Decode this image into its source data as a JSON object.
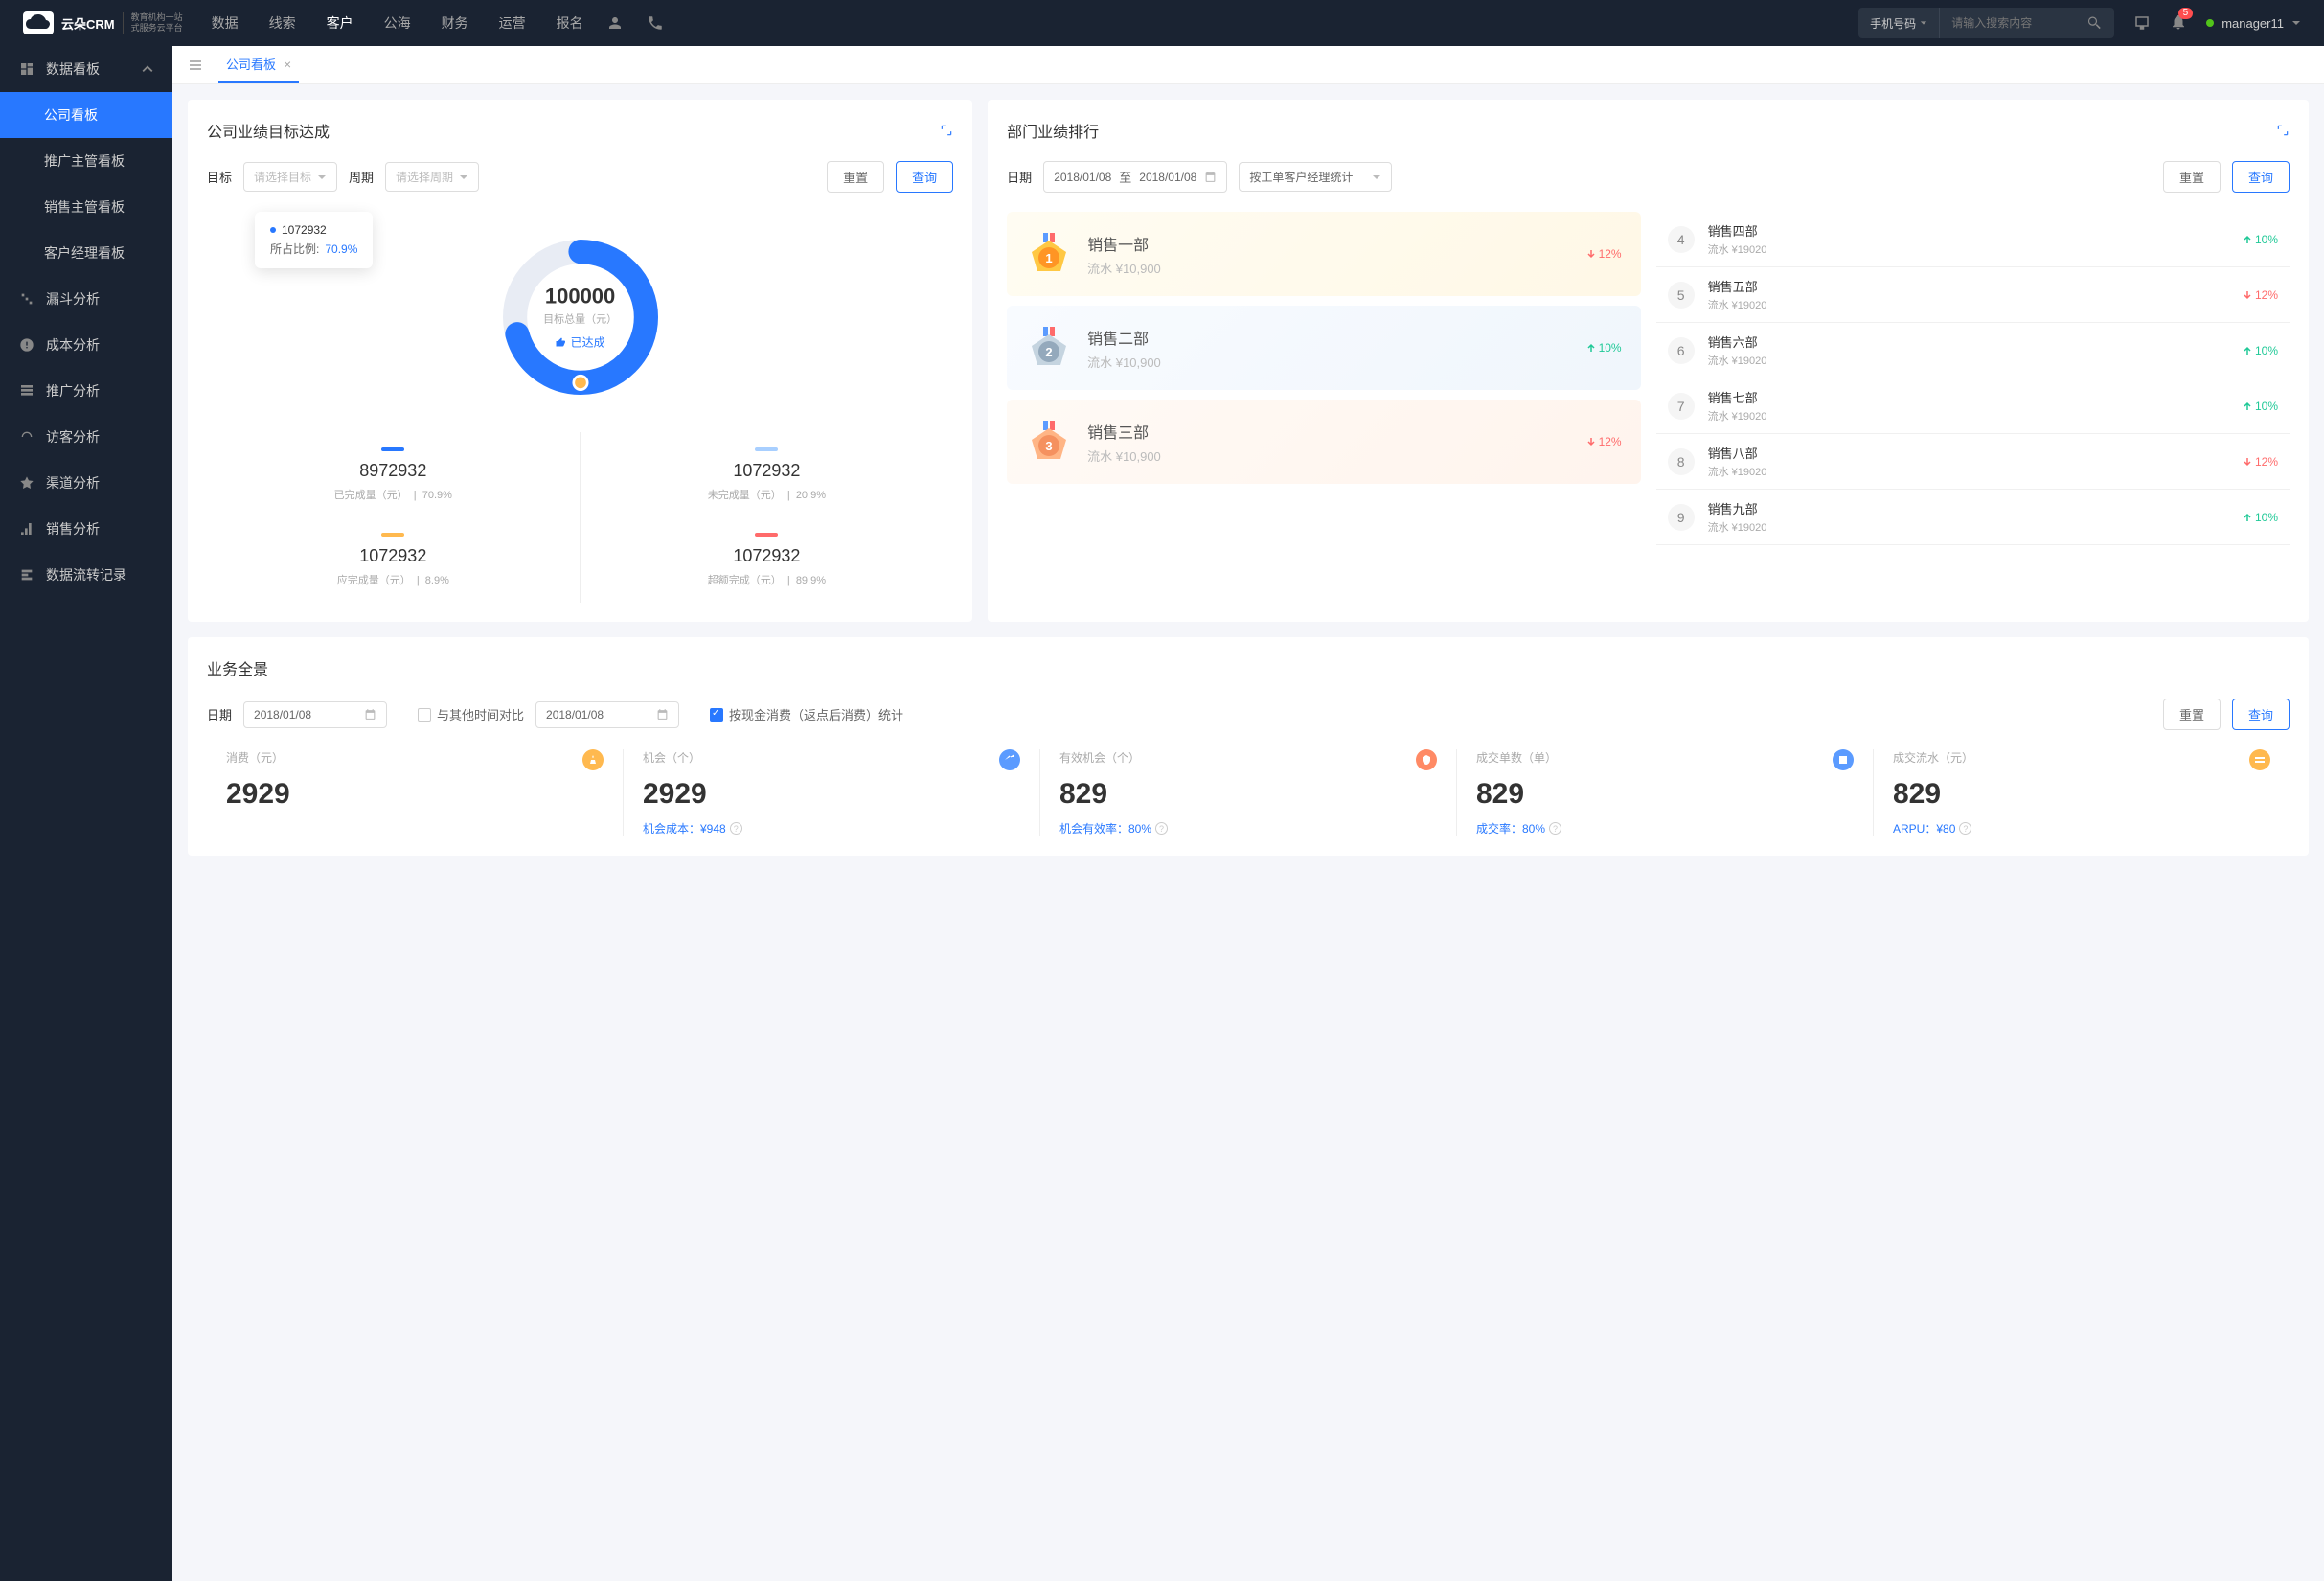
{
  "brand": {
    "name": "云朵CRM",
    "sub1": "教育机构一站",
    "sub2": "式服务云平台"
  },
  "nav": [
    "数据",
    "线索",
    "客户",
    "公海",
    "财务",
    "运营",
    "报名"
  ],
  "nav_active": 2,
  "search": {
    "type": "手机号码",
    "placeholder": "请输入搜索内容"
  },
  "notif_count": "5",
  "user": {
    "name": "manager11"
  },
  "sidebar": {
    "group_header": "数据看板",
    "items": [
      "公司看板",
      "推广主管看板",
      "销售主管看板",
      "客户经理看板"
    ],
    "active": 0,
    "links": [
      "漏斗分析",
      "成本分析",
      "推广分析",
      "访客分析",
      "渠道分析",
      "销售分析",
      "数据流转记录"
    ]
  },
  "tab": {
    "label": "公司看板"
  },
  "target_card": {
    "title": "公司业绩目标达成",
    "filter_target": "目标",
    "target_ph": "请选择目标",
    "filter_period": "周期",
    "period_ph": "请选择周期",
    "reset": "重置",
    "query": "查询",
    "tooltip": {
      "val": "1072932",
      "ratio_label": "所占比例:",
      "ratio": "70.9%"
    },
    "center": {
      "val": "100000",
      "label": "目标总量（元）",
      "badge": "已达成"
    },
    "stats": [
      {
        "color": "#2878ff",
        "val": "8972932",
        "label": "已完成量（元）",
        "pct": "70.9%"
      },
      {
        "color": "#a8cfff",
        "val": "1072932",
        "label": "未完成量（元）",
        "pct": "20.9%"
      },
      {
        "color": "#ffb94f",
        "val": "1072932",
        "label": "应完成量（元）",
        "pct": "8.9%"
      },
      {
        "color": "#ff6b6b",
        "val": "1072932",
        "label": "超额完成（元）",
        "pct": "89.9%"
      }
    ]
  },
  "rank_card": {
    "title": "部门业绩排行",
    "date_label": "日期",
    "date_from": "2018/01/08",
    "to": "至",
    "date_to": "2018/01/08",
    "group_by": "按工单客户经理统计",
    "reset": "重置",
    "query": "查询",
    "podium": [
      {
        "name": "销售一部",
        "rev": "流水 ¥10,900",
        "trend": "12%",
        "dir": "down"
      },
      {
        "name": "销售二部",
        "rev": "流水 ¥10,900",
        "trend": "10%",
        "dir": "up"
      },
      {
        "name": "销售三部",
        "rev": "流水 ¥10,900",
        "trend": "12%",
        "dir": "down"
      }
    ],
    "list": [
      {
        "n": "4",
        "name": "销售四部",
        "rev": "流水 ¥19020",
        "trend": "10%",
        "dir": "up"
      },
      {
        "n": "5",
        "name": "销售五部",
        "rev": "流水 ¥19020",
        "trend": "12%",
        "dir": "down"
      },
      {
        "n": "6",
        "name": "销售六部",
        "rev": "流水 ¥19020",
        "trend": "10%",
        "dir": "up"
      },
      {
        "n": "7",
        "name": "销售七部",
        "rev": "流水 ¥19020",
        "trend": "10%",
        "dir": "up"
      },
      {
        "n": "8",
        "name": "销售八部",
        "rev": "流水 ¥19020",
        "trend": "12%",
        "dir": "down"
      },
      {
        "n": "9",
        "name": "销售九部",
        "rev": "流水 ¥19020",
        "trend": "10%",
        "dir": "up"
      }
    ]
  },
  "overview_card": {
    "title": "业务全景",
    "date_label": "日期",
    "date1": "2018/01/08",
    "compare_label": "与其他时间对比",
    "date2": "2018/01/08",
    "check_label": "按现金消费（返点后消费）统计",
    "reset": "重置",
    "query": "查询",
    "kpis": [
      {
        "label": "消费（元）",
        "val": "2929",
        "sub": "",
        "icon_bg": "#ffb94f"
      },
      {
        "label": "机会（个）",
        "val": "2929",
        "sub": "机会成本：¥948",
        "icon_bg": "#5b9bff"
      },
      {
        "label": "有效机会（个）",
        "val": "829",
        "sub": "机会有效率：80%",
        "icon_bg": "#ff8a65"
      },
      {
        "label": "成交单数（单）",
        "val": "829",
        "sub": "成交率：80%",
        "icon_bg": "#5b9bff"
      },
      {
        "label": "成交流水（元）",
        "val": "829",
        "sub": "ARPU：¥80",
        "icon_bg": "#ffb94f"
      }
    ]
  },
  "chart_data": {
    "type": "pie",
    "title": "目标总量（元）",
    "total": 100000,
    "series": [
      {
        "name": "已完成量",
        "value": 70.9,
        "color": "#2878ff"
      },
      {
        "name": "未完成量",
        "value": 29.1,
        "color": "#e8ecf4"
      }
    ]
  }
}
